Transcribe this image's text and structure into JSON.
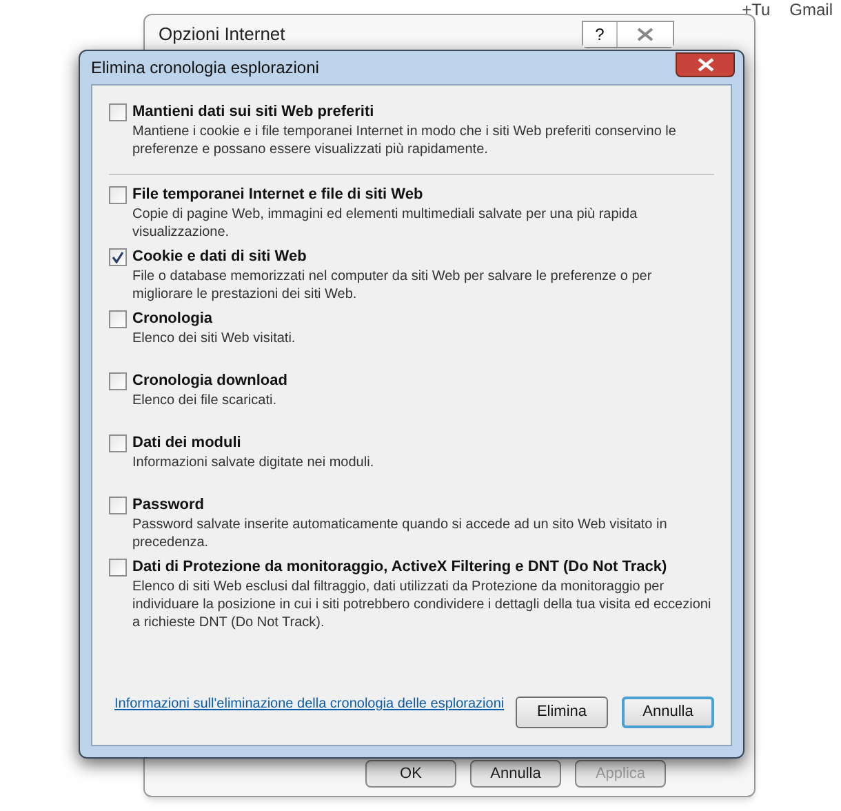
{
  "top_links": [
    "+Tu",
    "Gmail"
  ],
  "back_window": {
    "title": "Opzioni Internet",
    "help_button": "?",
    "buttons": [
      {
        "label": "OK",
        "disabled": false
      },
      {
        "label": "Annulla",
        "disabled": false
      },
      {
        "label": "Applica",
        "disabled": true
      }
    ]
  },
  "dialog": {
    "title": "Elimina cronologia esplorazioni",
    "groups": [
      [
        {
          "label": "Mantieni dati sui siti Web preferiti",
          "description": "Mantiene i cookie e i file temporanei Internet in modo che i siti Web preferiti conservino le preferenze e possano essere visualizzati più rapidamente.",
          "checked": false
        }
      ],
      [
        {
          "label": "File temporanei Internet e file di siti Web",
          "description": "Copie di pagine Web, immagini ed elementi multimediali salvate per una più rapida visualizzazione.",
          "checked": false
        },
        {
          "label": "Cookie e dati di siti Web",
          "description": "File o database memorizzati nel computer da siti Web per salvare le preferenze o per migliorare le prestazioni dei siti Web.",
          "checked": true
        },
        {
          "label": "Cronologia",
          "description": "Elenco dei siti Web visitati.",
          "checked": false
        },
        {
          "label": "Cronologia download",
          "description": "Elenco dei file scaricati.",
          "checked": false
        },
        {
          "label": "Dati dei moduli",
          "description": "Informazioni salvate digitate nei moduli.",
          "checked": false
        },
        {
          "label": "Password",
          "description": "Password salvate inserite automaticamente quando si accede ad un sito Web visitato in precedenza.",
          "checked": false
        },
        {
          "label": "Dati di Protezione da monitoraggio, ActiveX Filtering e DNT (Do Not Track)",
          "description": "Elenco di siti Web esclusi dal filtraggio, dati utilizzati da Protezione da monitoraggio per individuare la posizione in cui i siti potrebbero condividere i dettagli della tua visita ed eccezioni a richieste DNT (Do Not Track).",
          "checked": false
        }
      ]
    ],
    "info_link": "Informazioni sull'eliminazione della cronologia delle esplorazioni",
    "buttons": [
      {
        "label": "Elimina",
        "default": false
      },
      {
        "label": "Annulla",
        "default": true
      }
    ]
  }
}
